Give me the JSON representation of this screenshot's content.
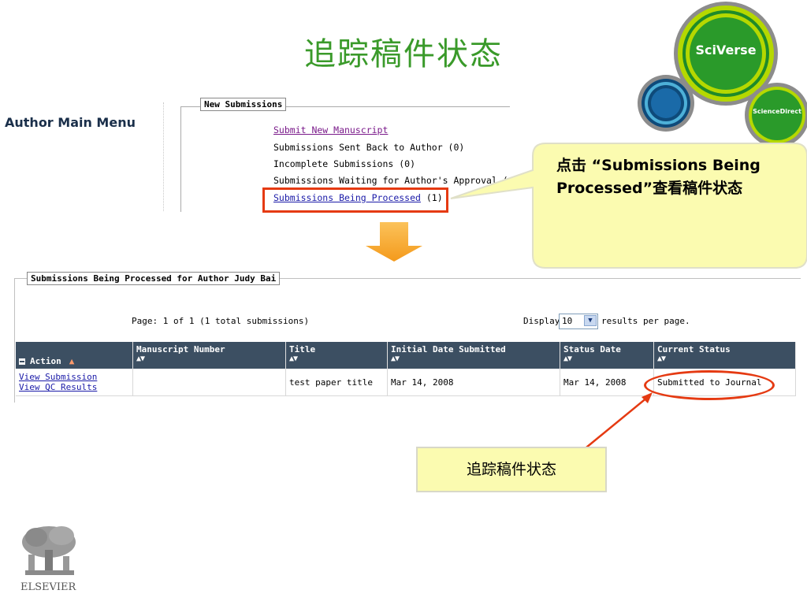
{
  "slide": {
    "title": "追踪稿件状态"
  },
  "logos": {
    "sciverse": "SciVerse",
    "sciencedirect": "ScienceDirect",
    "elsevier": "ELSEVIER"
  },
  "author_menu": {
    "heading": "Author Main Menu",
    "section_legend": "New Submissions",
    "items": [
      {
        "label": "Submit New Manuscript",
        "link": true
      },
      {
        "label": "Submissions Sent Back to Author (0)",
        "link": false
      },
      {
        "label": "Incomplete Submissions (0)",
        "link": false
      },
      {
        "label": "Submissions Waiting for Author's Approval (0)",
        "link": false
      },
      {
        "label": "Submissions Being Processed",
        "count": "(1)",
        "link": true
      }
    ]
  },
  "callout": {
    "text_part1": "点击 “Submissions Being",
    "text_part2": "Processed”查看稿件状态"
  },
  "processing": {
    "legend": "Submissions Being Processed for Author Judy Bai",
    "page_info": "Page: 1 of 1 (1 total submissions)",
    "display_label": "Display",
    "display_value": "10",
    "results_label": "results per page.",
    "columns": [
      "Action",
      "Manuscript Number",
      "Title",
      "Initial Date Submitted",
      "Status Date",
      "Current Status"
    ],
    "sort_glyph": "▲▼",
    "rows": [
      {
        "actions": [
          "View Submission",
          "View QC Results"
        ],
        "manuscript_number": "",
        "title": "test paper title",
        "initial_date": "Mar 14, 2008",
        "status_date": "Mar 14, 2008",
        "current_status": "Submitted to Journal"
      }
    ]
  },
  "annotation": {
    "text": "追踪稿件状态"
  },
  "colors": {
    "title_green": "#3a9a2a",
    "highlight_red": "#e53a12",
    "callout_yellow": "#fbfbb0",
    "arrow_orange": "#f7a028",
    "table_header": "#3c4f62"
  }
}
